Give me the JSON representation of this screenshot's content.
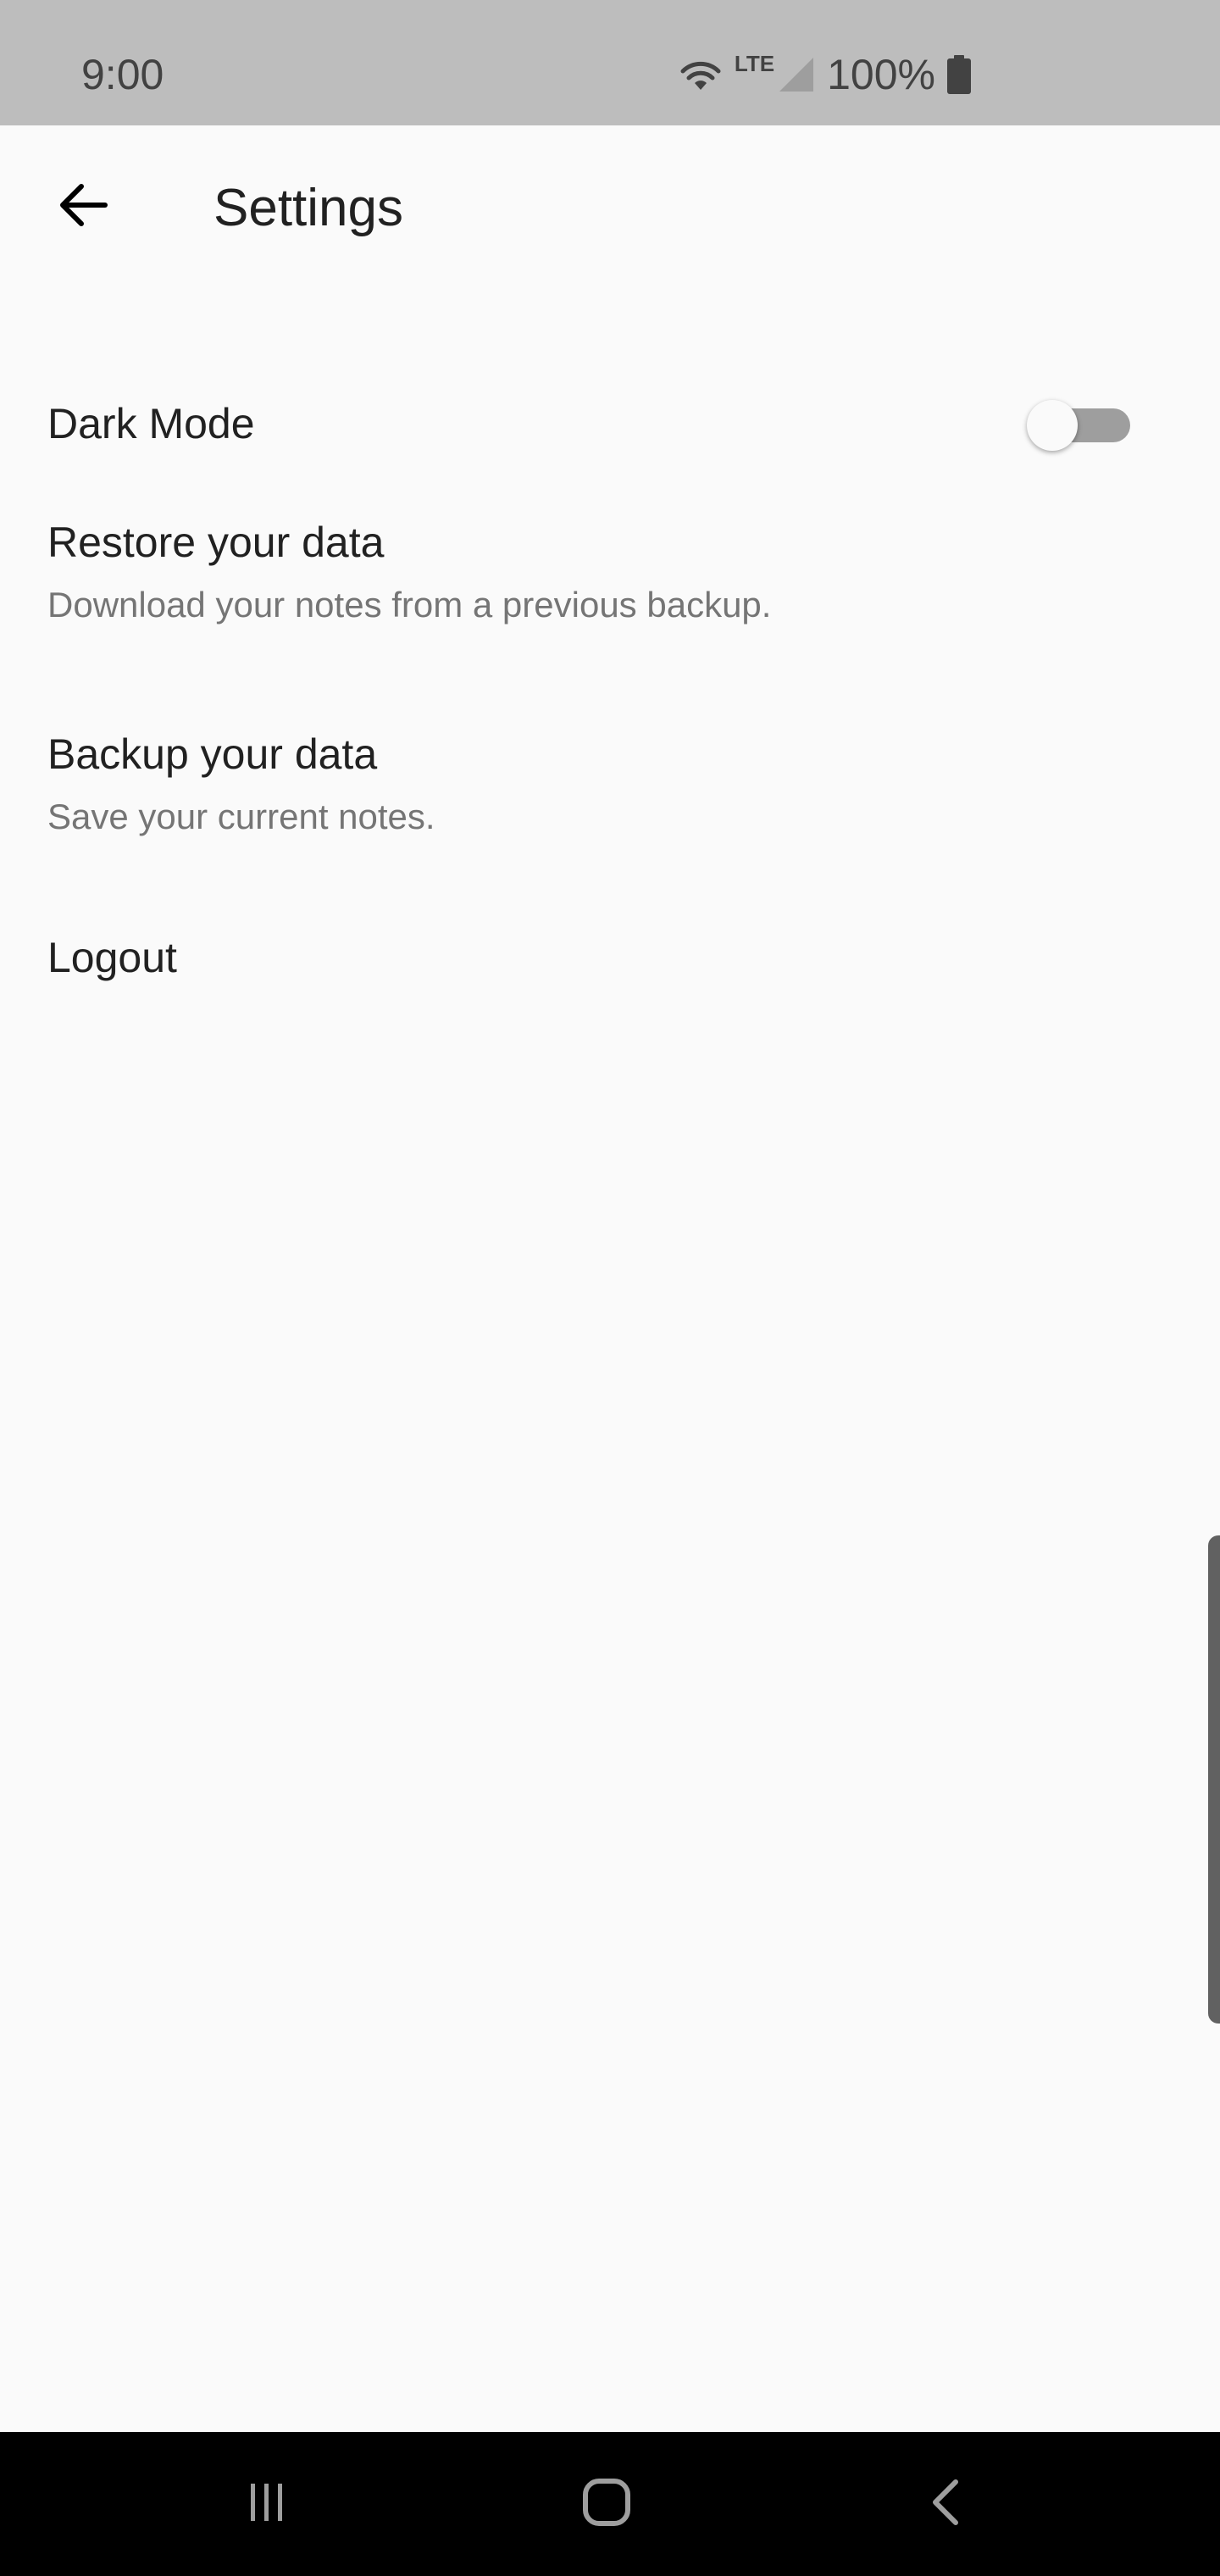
{
  "status_bar": {
    "time": "9:00",
    "network_label": "LTE",
    "battery_text": "100%",
    "icons": [
      "wifi-icon",
      "cellular-signal-icon",
      "battery-icon"
    ]
  },
  "app_bar": {
    "back_icon": "arrow-left-icon",
    "title": "Settings"
  },
  "settings": {
    "dark_mode": {
      "title": "Dark Mode",
      "enabled": false
    },
    "restore": {
      "title": "Restore your data",
      "subtitle": "Download your notes from a previous backup."
    },
    "backup": {
      "title": "Backup your data",
      "subtitle": "Save your current notes."
    },
    "logout": {
      "title": "Logout"
    }
  },
  "nav_bar": {
    "icons": [
      "recents-icon",
      "home-icon",
      "back-icon"
    ]
  },
  "colors": {
    "status_bar_bg": "#bdbdbd",
    "page_bg": "#fafafa",
    "primary_text": "#212121",
    "secondary_text": "#757575",
    "toggle_track_off": "#9e9e9e",
    "nav_bar_bg": "#000000"
  }
}
